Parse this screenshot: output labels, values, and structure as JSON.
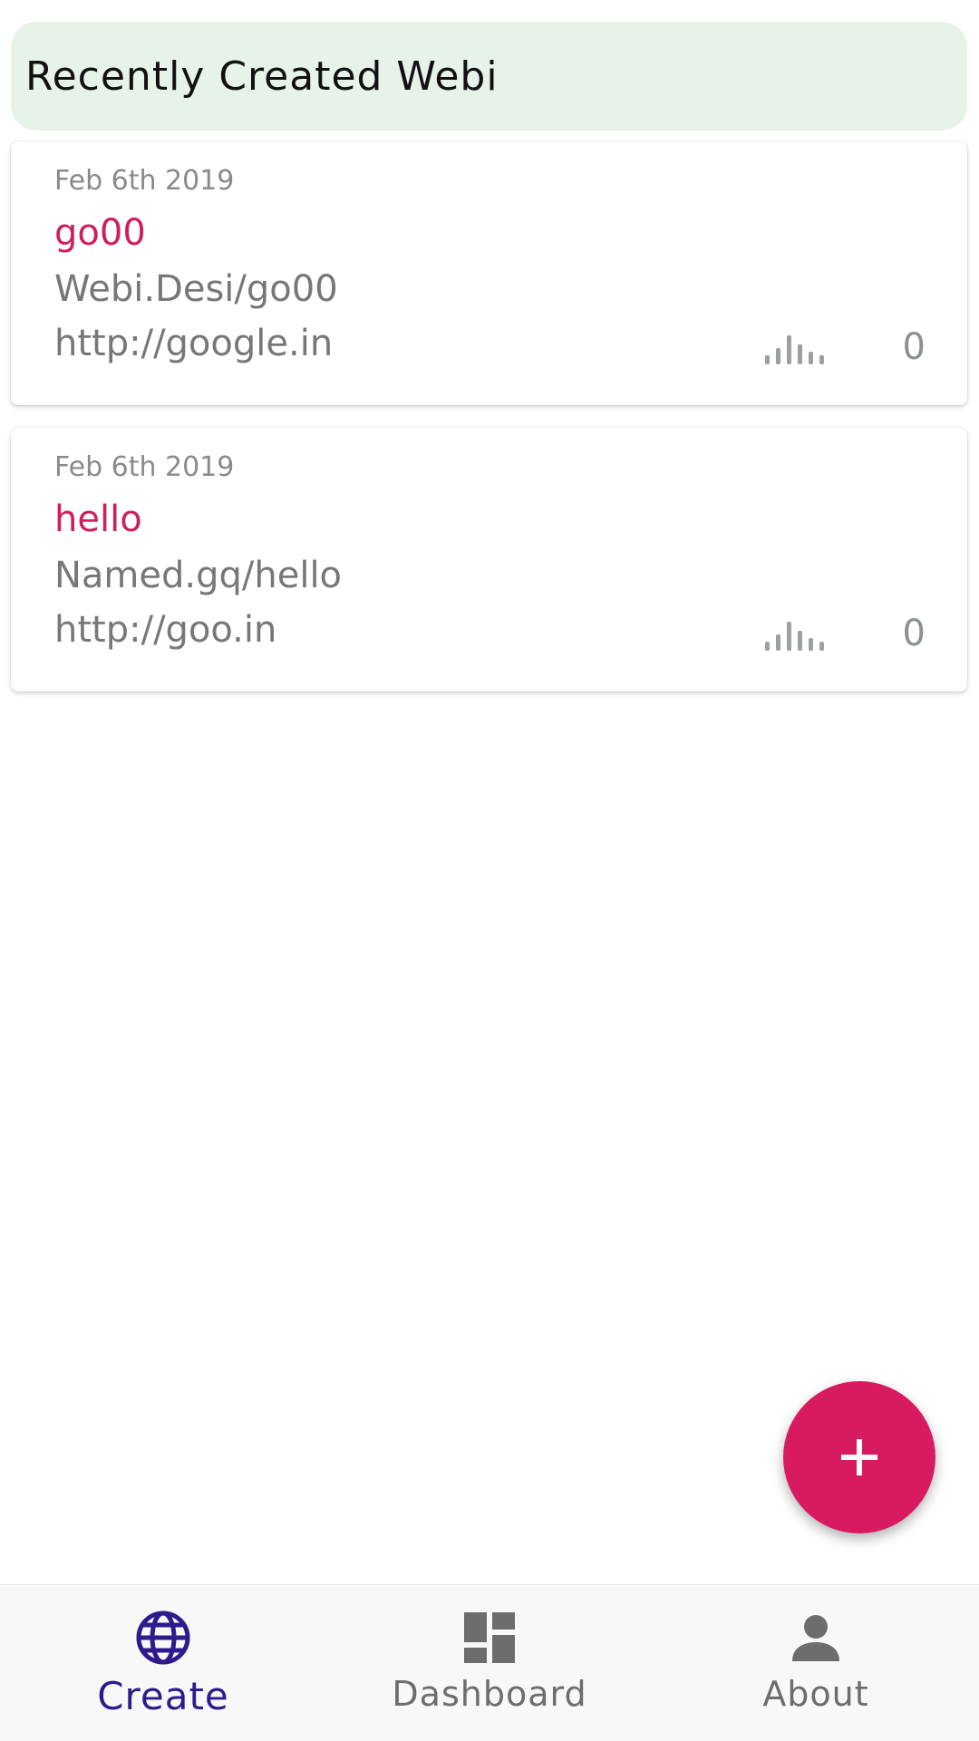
{
  "header": {
    "title": "Recently Created Webi"
  },
  "cards": [
    {
      "date": "Feb 6th 2019",
      "name": "go00",
      "short_link": "Webi.Desi/go00",
      "url": "http://google.in",
      "count": "0",
      "icon": "stats-bars-icon"
    },
    {
      "date": "Feb 6th 2019",
      "name": "hello",
      "short_link": "Named.gq/hello",
      "url": "http://goo.in",
      "count": "0",
      "icon": "stats-bars-icon"
    }
  ],
  "fab": {
    "icon": "plus-icon",
    "color": "#d81b60"
  },
  "bottom_nav": {
    "items": [
      {
        "label": "Create",
        "icon": "globe-icon",
        "active": true
      },
      {
        "label": "Dashboard",
        "icon": "dashboard-icon",
        "active": false
      },
      {
        "label": "About",
        "icon": "person-icon",
        "active": false
      }
    ],
    "active_color": "#2e1a8c",
    "inactive_color": "#6d6d6d"
  },
  "colors": {
    "header_bg": "#e7f3e8",
    "link_name": "#cf1e5d",
    "secondary_text": "#777777"
  }
}
